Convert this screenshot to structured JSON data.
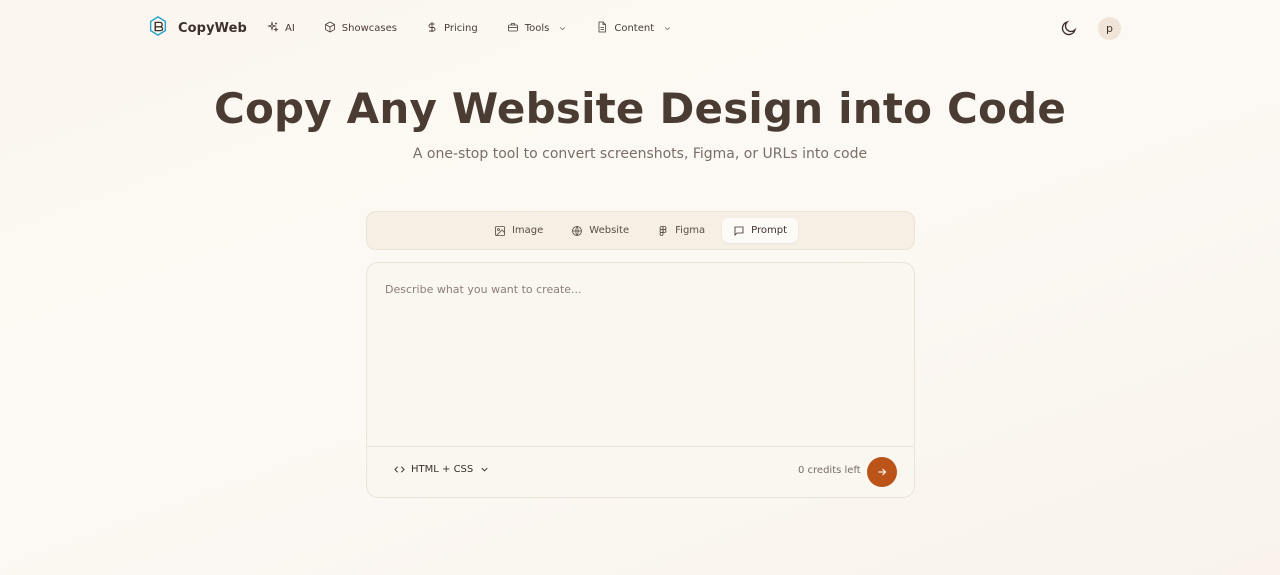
{
  "brand": {
    "name": "CopyWeb",
    "icon": "logo-icon"
  },
  "nav": [
    {
      "label": "AI",
      "icon": "sparkles-icon",
      "dropdown": false
    },
    {
      "label": "Showcases",
      "icon": "box-icon",
      "dropdown": false
    },
    {
      "label": "Pricing",
      "icon": "dollar-icon",
      "dropdown": false
    },
    {
      "label": "Tools",
      "icon": "toolbox-icon",
      "dropdown": true
    },
    {
      "label": "Content",
      "icon": "document-icon",
      "dropdown": true
    }
  ],
  "header": {
    "theme_icon": "moon-icon",
    "avatar_initial": "p"
  },
  "hero": {
    "title": "Copy Any Website Design into Code",
    "subtitle": "A one-stop tool to convert screenshots, Figma, or URLs into code"
  },
  "tabs": [
    {
      "label": "Image",
      "icon": "image-icon",
      "active": false
    },
    {
      "label": "Website",
      "icon": "globe-icon",
      "active": false
    },
    {
      "label": "Figma",
      "icon": "figma-icon",
      "active": false
    },
    {
      "label": "Prompt",
      "icon": "chat-icon",
      "active": true
    }
  ],
  "prompt": {
    "placeholder": "Describe what you want to create...",
    "value": "",
    "format_label": "HTML + CSS",
    "credits_text": "0 credits left"
  },
  "colors": {
    "accent": "#bb5418",
    "text": "#3d302a",
    "muted": "#7a6e66"
  }
}
